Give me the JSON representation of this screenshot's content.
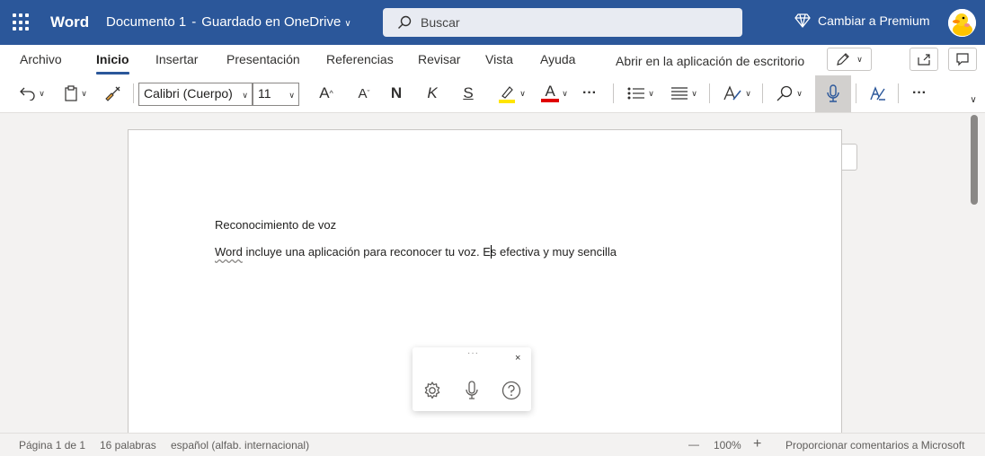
{
  "titlebar": {
    "app_name": "Word",
    "doc_name": "Documento 1",
    "separator": "-",
    "save_status": "Guardado en OneDrive",
    "search_placeholder": "Buscar",
    "premium_label": "Cambiar a Premium"
  },
  "tabs": [
    {
      "label": "Archivo"
    },
    {
      "label": "Inicio"
    },
    {
      "label": "Insertar"
    },
    {
      "label": "Presentación"
    },
    {
      "label": "Referencias"
    },
    {
      "label": "Revisar"
    },
    {
      "label": "Vista"
    },
    {
      "label": "Ayuda"
    }
  ],
  "active_tab": "Inicio",
  "open_desktop_label": "Abrir en la aplicación de escritorio",
  "toolbar": {
    "font_name": "Calibri (Cuerpo)",
    "font_size": "11",
    "bold_glyph": "N",
    "italic_glyph": "K",
    "underline_glyph": "S",
    "grow_glyph": "A",
    "shrink_glyph": "A",
    "font_color_glyph": "A",
    "more_glyph": "···",
    "highlight_color": "#ffe500",
    "font_color": "#e00000"
  },
  "document": {
    "heading": "Reconocimiento de voz",
    "para_word": "Word",
    "para_mid": " incluye una aplicación para reconocer tu voz. E",
    "para_end": "s efectiva y muy sencilla"
  },
  "dictation": {
    "grip": "···",
    "close": "×"
  },
  "statusbar": {
    "page": "Página 1 de 1",
    "words": "16 palabras",
    "language": "español (alfab. internacional)",
    "zoom_out": "—",
    "zoom": "100%",
    "zoom_in": "+",
    "feedback": "Proporcionar comentarios a Microsoft"
  },
  "colors": {
    "brand": "#2b579a",
    "canvas": "#f3f2f1"
  }
}
